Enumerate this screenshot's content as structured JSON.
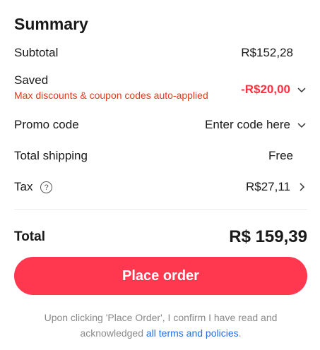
{
  "summary": {
    "title": "Summary",
    "subtotal": {
      "label": "Subtotal",
      "value": "R$152,28"
    },
    "saved": {
      "label": "Saved",
      "note": "Max discounts & coupon codes auto-applied",
      "value": "-R$20,00"
    },
    "promo": {
      "label": "Promo code",
      "value": "Enter code here"
    },
    "shipping": {
      "label": "Total shipping",
      "value": "Free"
    },
    "tax": {
      "label": "Tax",
      "help_glyph": "?",
      "value": "R$27,11"
    },
    "total": {
      "label": "Total",
      "value": "R$ 159,39"
    },
    "place_order_label": "Place order",
    "legal": {
      "text": "Upon clicking 'Place Order', I confirm I have read and acknowledged ",
      "link": "all terms and policies",
      "suffix": "."
    }
  },
  "colors": {
    "accent": "#ff3850",
    "saved_value": "#ff3040",
    "saved_note": "#e8371f",
    "link": "#1f6fe0"
  },
  "icons": [
    "chevron-down-icon",
    "chevron-right-icon",
    "help-circle-icon"
  ]
}
